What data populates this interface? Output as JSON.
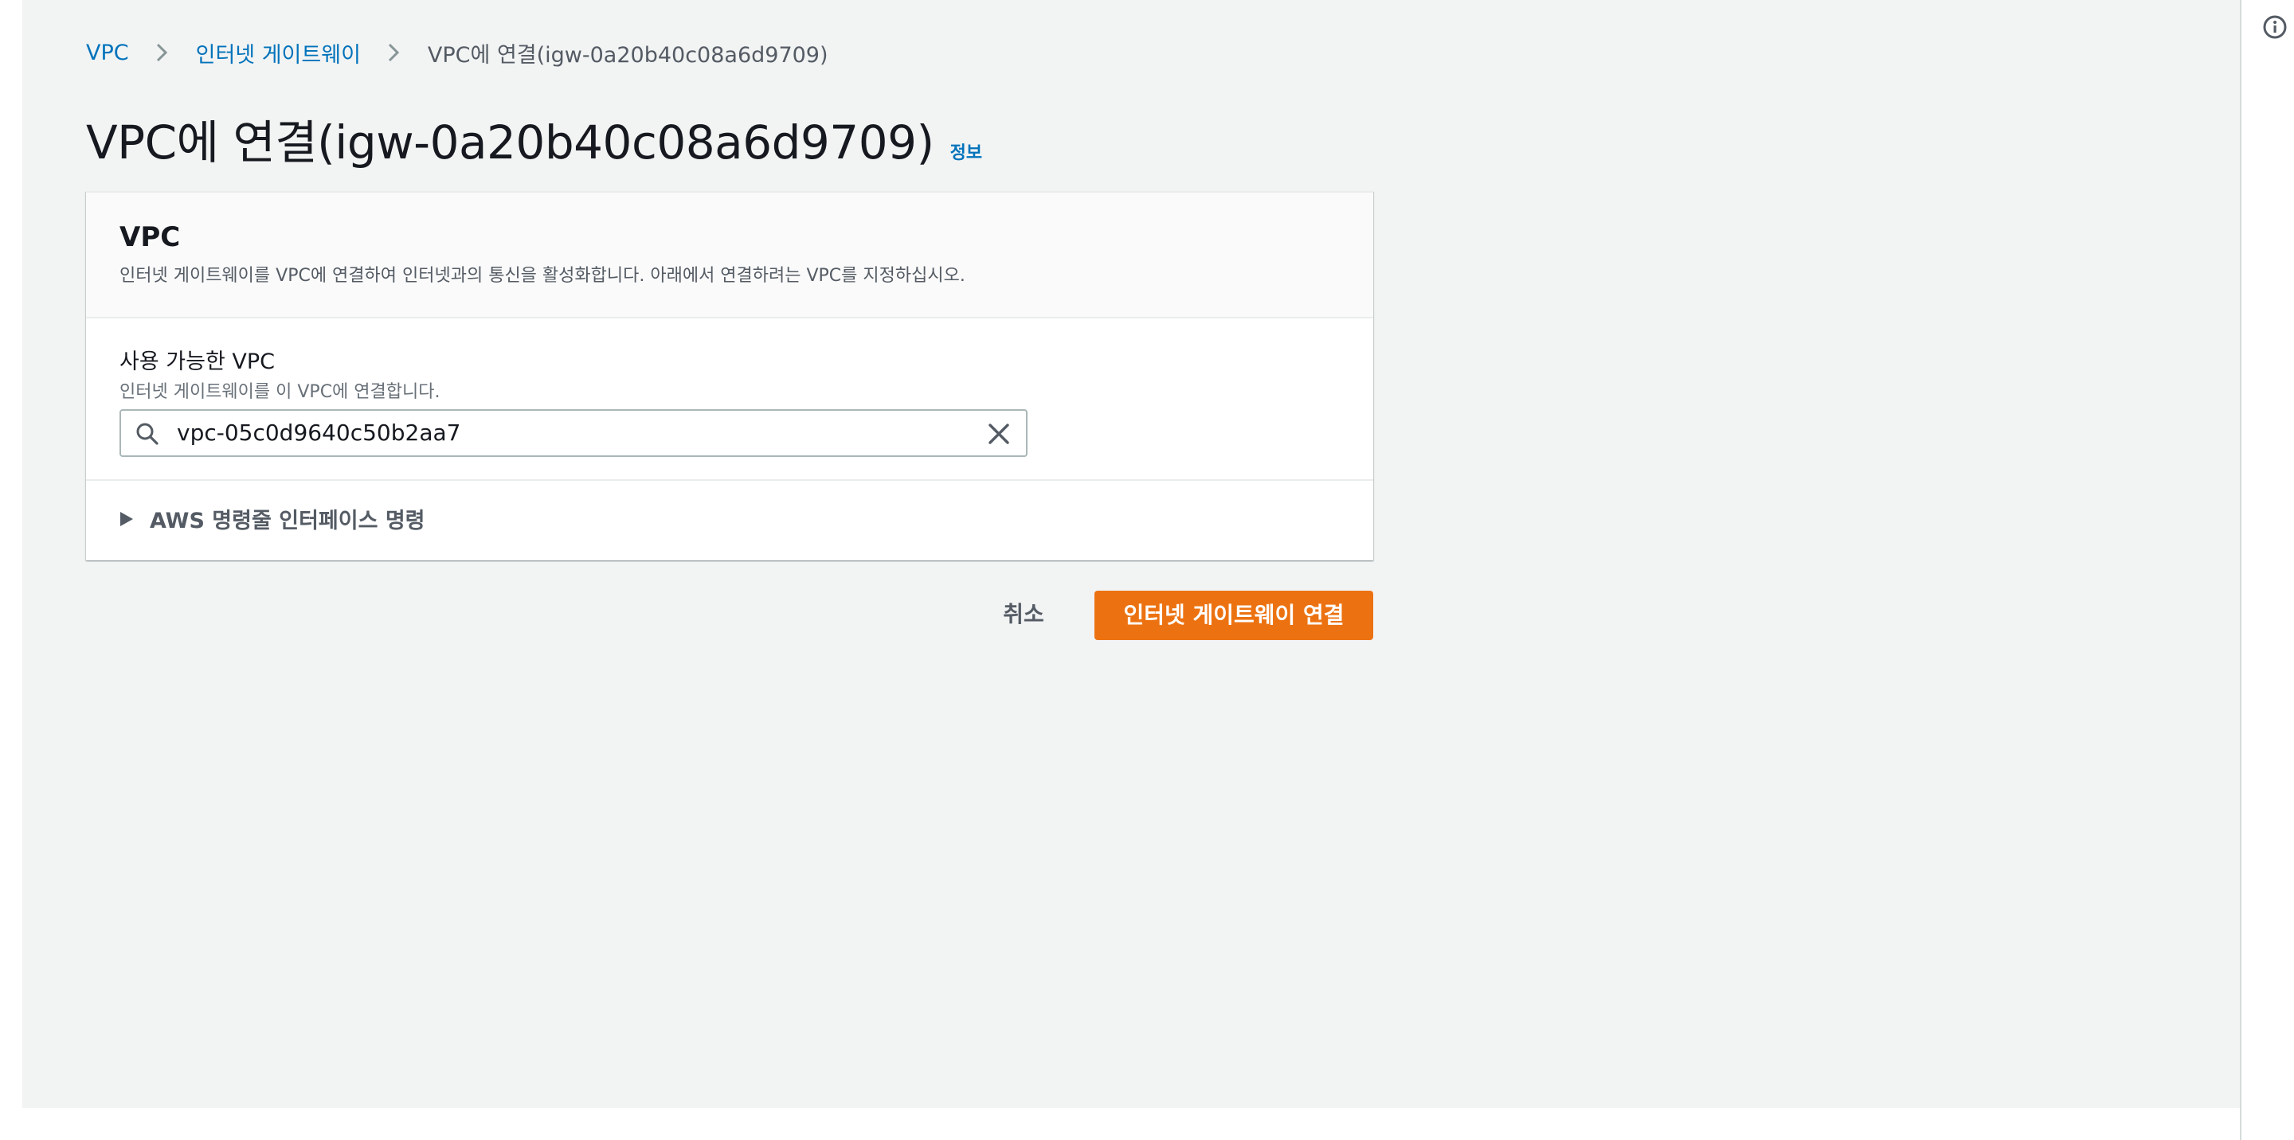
{
  "breadcrumb": {
    "items": [
      {
        "label": "VPC"
      },
      {
        "label": "인터넷 게이트웨이"
      }
    ],
    "current": "VPC에 연결(igw-0a20b40c08a6d9709)"
  },
  "page": {
    "title": "VPC에 연결(igw-0a20b40c08a6d9709)",
    "info_link": "정보"
  },
  "panel": {
    "title": "VPC",
    "description": "인터넷 게이트웨이를 VPC에 연결하여 인터넷과의 통신을 활성화합니다. 아래에서 연결하려는 VPC를 지정하십시오.",
    "field": {
      "label": "사용 가능한 VPC",
      "description": "인터넷 게이트웨이를 이 VPC에 연결합니다.",
      "value": "vpc-05c0d9640c50b2aa7"
    },
    "expander_label": "AWS 명령줄 인터페이스 명령"
  },
  "actions": {
    "cancel_label": "취소",
    "submit_label": "인터넷 게이트웨이 연결"
  },
  "icons": {
    "right_rail": "info-icon",
    "search": "search-icon",
    "clear": "close-icon",
    "expander": "caret-right-icon",
    "breadcrumb_separator": "chevron-right-icon"
  },
  "colors": {
    "link": "#0073bb",
    "primary_button": "#ec7211",
    "background": "#f2f3f3"
  }
}
